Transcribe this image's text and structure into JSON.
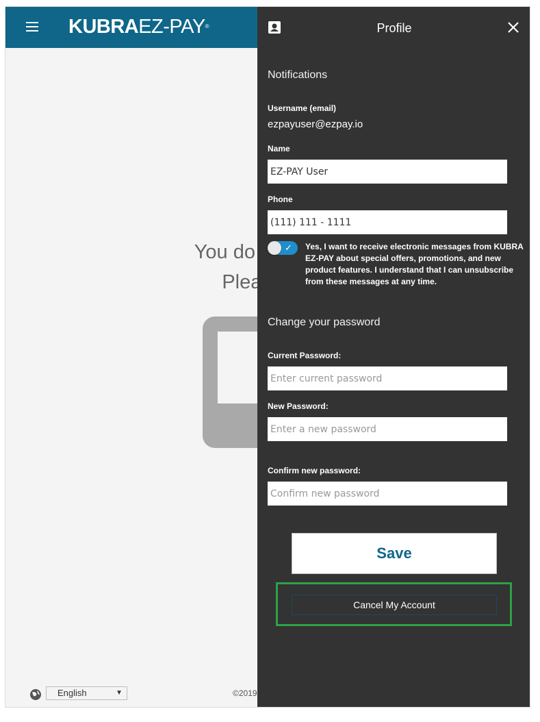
{
  "app": {
    "logo_bold": "KUBRA",
    "logo_light": "EZ-PAY",
    "logo_mark": "®"
  },
  "empty_state": {
    "line1": "You do not have",
    "line2": "Please ac"
  },
  "footer": {
    "language": "English",
    "copyright": "©2019"
  },
  "profile_panel": {
    "title": "Profile",
    "notifications_heading": "Notifications",
    "username_label": "Username (email)",
    "username_value": "ezpayuser@ezpay.io",
    "name_label": "Name",
    "name_value": "EZ-PAY User",
    "phone_label": "Phone",
    "phone_value": "(111) 111 - 1111",
    "consent_text": "Yes, I want to receive electronic messages from KUBRA EZ-PAY about special offers, promotions, and new product features. I understand that I can unsubscribe from these messages at any time.",
    "consent_checked": true,
    "password_heading": "Change your password",
    "current_password_label": "Current Password:",
    "current_password_placeholder": "Enter current password",
    "new_password_label": "New Password:",
    "new_password_placeholder": "Enter a new password",
    "confirm_password_label": "Confirm new password:",
    "confirm_password_placeholder": "Confirm new password",
    "save_label": "Save",
    "cancel_account_label": "Cancel My Account"
  },
  "colors": {
    "brand": "#0f6688",
    "panel_bg": "#333333",
    "toggle_on": "#1f8ecb",
    "highlight": "#2da146"
  }
}
